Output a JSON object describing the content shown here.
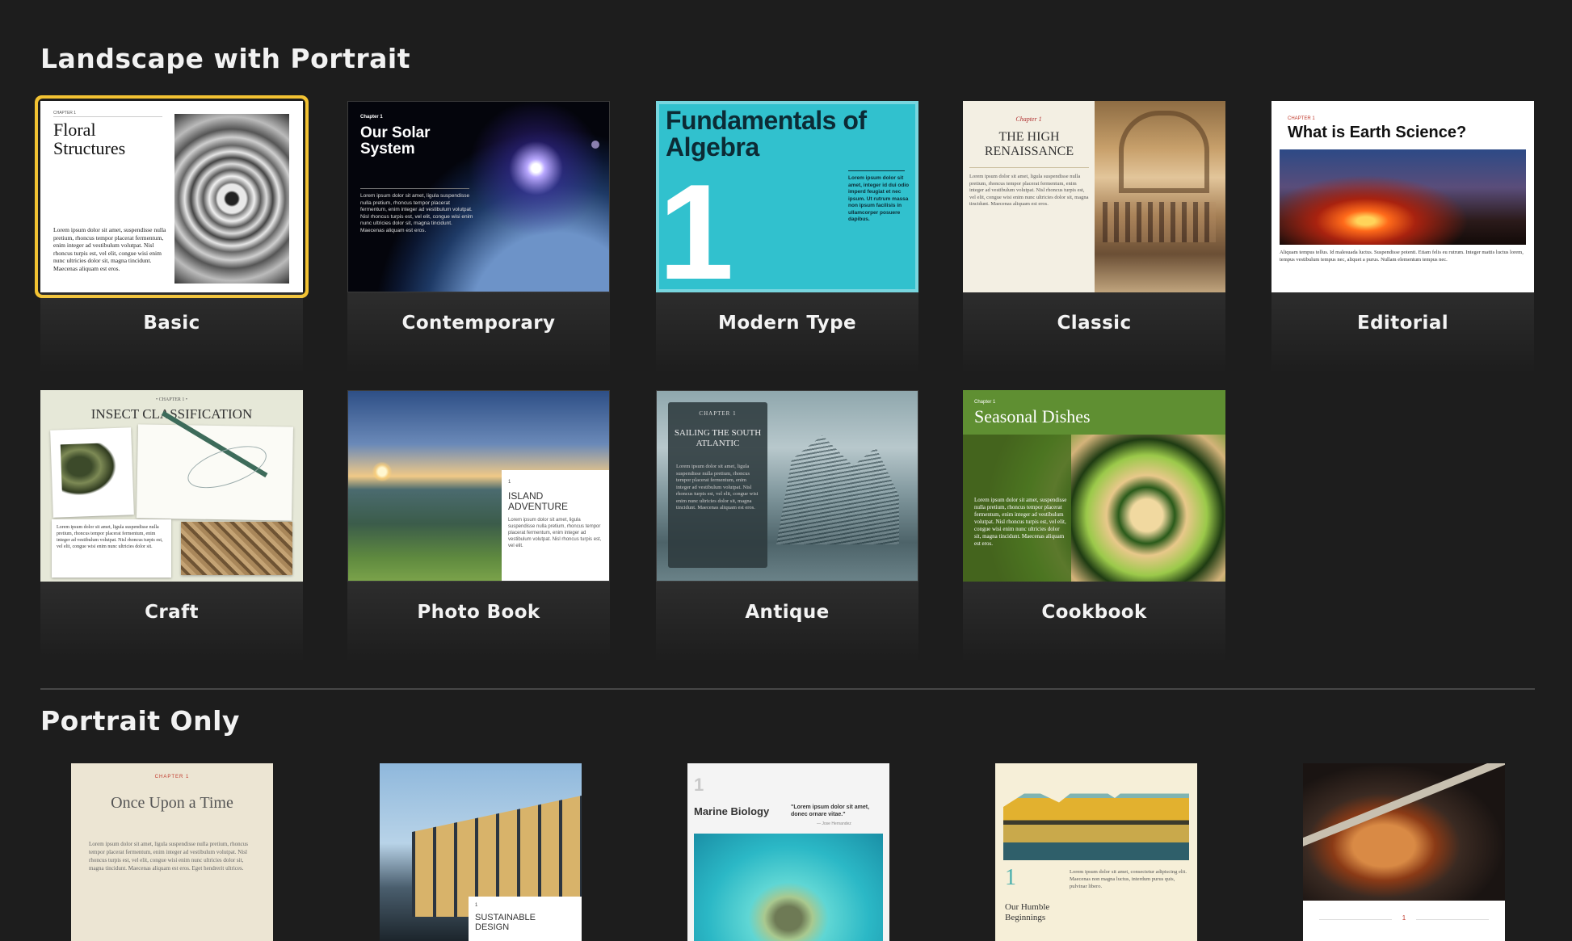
{
  "sections": {
    "landscape_title": "Landscape with Portrait",
    "portrait_title": "Portrait Only"
  },
  "colors": {
    "selection": "#f2c232",
    "background": "#1d1d1d"
  },
  "templates": [
    {
      "label": "Basic",
      "thumb_title": "Floral Structures",
      "chapter": "CHAPTER 1",
      "body": "Lorem ipsum dolor sit amet, suspendisse nulla pretium, rhoncus tempor placerat fermentum, enim integer ad vestibulum volutpat. Nisl rhoncus turpis est, vel elit, congue wisi enim nunc ultricies dolor sit, magna tincidunt. Maecenas aliquam est eros.",
      "selected": true
    },
    {
      "label": "Contemporary",
      "thumb_title": "Our Solar System",
      "chapter": "Chapter 1",
      "body": "Lorem ipsum dolor sit amet, ligula suspendisse nulla pretium, rhoncus tempor placerat fermentum, enim integer ad vestibulum volutpat. Nisl rhoncus turpis est, vel elit, congue wisi enim nunc ultricies dolor sit, magna tincidunt. Maecenas aliquam est eros."
    },
    {
      "label": "Modern Type",
      "thumb_title": "Fundamentals of Algebra",
      "number": "1",
      "body": "Lorem ipsum dolor sit amet, integer id dui odio imperd feugiat et nec ipsum. Ut rutrum massa non ipsum facilisis in ullamcorper posuere dapibus."
    },
    {
      "label": "Classic",
      "thumb_title": "THE HIGH RENAISSANCE",
      "chapter": "Chapter 1",
      "body": "Lorem ipsum dolor sit amet, ligula suspendisse nulla pretium, rhoncus tempor placerat fermentum, enim integer ad vestibulum volutpat. Nisl rhoncus turpis est, vel elit, congue wisi enim nunc ultricies dolor sit, magna tincidunt. Maecenas aliquam est eros."
    },
    {
      "label": "Editorial",
      "thumb_title": "What is Earth Science?",
      "chapter": "CHAPTER 1",
      "body": "Aliquam tempus tellus. Id malesuada luctus. Suspendisse potenti. Etiam felis eu rutrum. Integer mattis luctus lorem, tempus vestibulum tempus nec, aliquet a purus. Nullam elementum tempus nec."
    },
    {
      "label": "Craft",
      "thumb_title": "INSECT CLASSIFICATION",
      "chapter": "• CHAPTER 1 •",
      "body": "Lorem ipsum dolor sit amet, ligula suspendisse nulla pretium, rhoncus tempor placerat fermentum, enim integer ad vestibulum volutpat. Nisl rhoncus turpis est, vel elit, congue wisi enim nunc ultricies dolor sit."
    },
    {
      "label": "Photo Book",
      "thumb_title": "ISLAND ADVENTURE",
      "chapter": "1",
      "body": "Lorem ipsum dolor sit amet, ligula suspendisse nulla pretium, rhoncus tempor placerat fermentum, enim integer ad vestibulum volutpat. Nisl rhoncus turpis est, vel elit."
    },
    {
      "label": "Antique",
      "thumb_title": "SAILING THE SOUTH ATLANTIC",
      "chapter": "CHAPTER 1",
      "body": "Lorem ipsum dolor sit amet, ligula suspendisse nulla pretium, rhoncus tempor placerat fermentum, enim integer ad vestibulum volutpat. Nisl rhoncus turpis est, vel elit, congue wisi enim nunc ultricies dolor sit, magna tincidunt. Maecenas aliquam est eros."
    },
    {
      "label": "Cookbook",
      "thumb_title": "Seasonal Dishes",
      "chapter": "Chapter 1",
      "body": "Lorem ipsum dolor sit amet, suspendisse nulla pretium, rhoncus tempor placerat fermentum, enim integer ad vestibulum volutpat. Nisl rhoncus turpis est, vel elit, congue wisi enim nunc ultricies dolor sit, magna tincidunt. Maecenas aliquam est eros."
    }
  ],
  "portrait": [
    {
      "thumb_title": "Once Upon a Time",
      "chapter": "CHAPTER 1",
      "body": "Lorem ipsum dolor sit amet, ligula suspendisse nulla pretium, rhoncus tempor placerat fermentum, enim integer ad vestibulum volutpat. Nisl rhoncus turpis est, vel elit, congue wisi enim nunc ultricies dolor sit, magna tincidunt. Maecenas aliquam est eros. Eget hendrerit ultrices."
    },
    {
      "thumb_title": "SUSTAINABLE DESIGN",
      "chapter": "1"
    },
    {
      "thumb_title": "Marine Biology",
      "number": "1",
      "quote": "\"Lorem ipsum dolor sit amet, donec ornare vitae.\"",
      "quote_by": "— Jose Hernandez"
    },
    {
      "thumb_title": "Our Humble Beginnings",
      "number": "1",
      "body": "Lorem ipsum dolor sit amet, consectetur adipiscing elit. Maecenas non magna luctus, interdum purus quis, pulvinar libero."
    },
    {
      "thumb_title": "",
      "page_number": "1"
    }
  ]
}
